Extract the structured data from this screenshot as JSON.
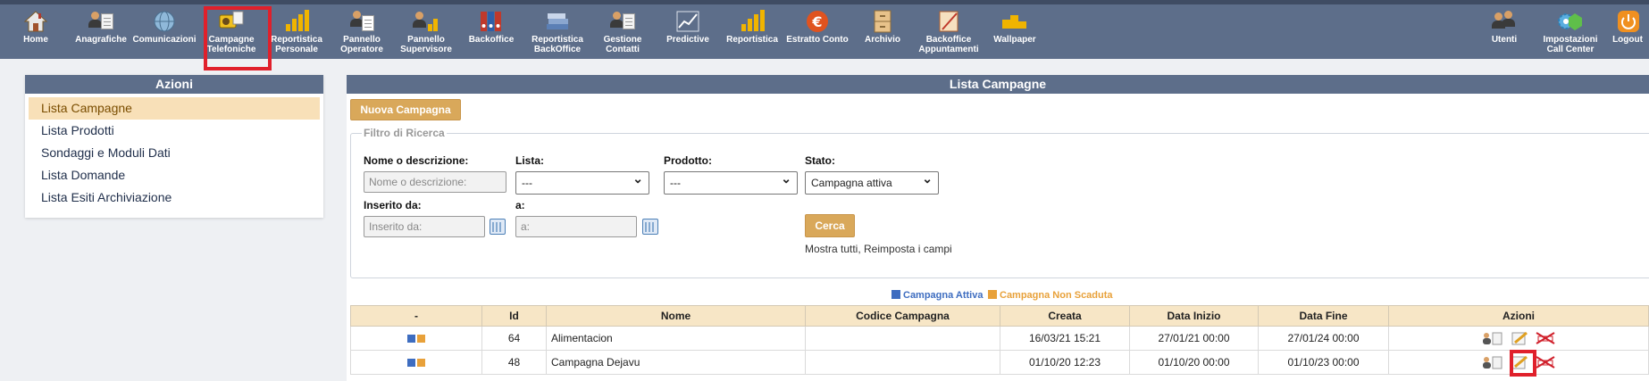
{
  "toolbar": {
    "items": [
      {
        "label": "Home",
        "icon": "home-icon"
      },
      {
        "label": "Anagrafiche",
        "icon": "registry-icon"
      },
      {
        "label": "Comunicazioni",
        "icon": "globe-icon"
      },
      {
        "label": "Campagne Telefoniche",
        "icon": "campaign-icon"
      },
      {
        "label": "Reportistica Personale",
        "icon": "chart-icon"
      },
      {
        "label": "Pannello Operatore",
        "icon": "operator-icon"
      },
      {
        "label": "Pannello Supervisore",
        "icon": "supervisor-icon"
      },
      {
        "label": "Backoffice",
        "icon": "binders-icon"
      },
      {
        "label": "Reportistica BackOffice",
        "icon": "books-icon"
      },
      {
        "label": "Gestione Contatti",
        "icon": "contacts-icon"
      },
      {
        "label": "Predictive",
        "icon": "trend-chart-icon"
      },
      {
        "label": "Reportistica",
        "icon": "bar-chart-icon"
      },
      {
        "label": "Estratto Conto",
        "icon": "euro-icon"
      },
      {
        "label": "Archivio",
        "icon": "cabinet-icon"
      },
      {
        "label": "Backoffice Appuntamenti",
        "icon": "calendar-edit-icon"
      },
      {
        "label": "Wallpaper",
        "icon": "wallpaper-icon"
      },
      {
        "label": "Utenti",
        "icon": "users-icon"
      },
      {
        "label": "Impostazioni Call Center",
        "icon": "settings-icon"
      },
      {
        "label": "Logout",
        "icon": "power-icon"
      }
    ]
  },
  "left_panel": {
    "title": "Azioni",
    "items": [
      "Lista Campagne",
      "Lista Prodotti",
      "Sondaggi e Moduli Dati",
      "Lista Domande",
      "Lista Esiti Archiviazione"
    ]
  },
  "main": {
    "title": "Lista Campagne",
    "new_button": "Nuova Campagna",
    "filter": {
      "legend": "Filtro di Ricerca",
      "name_label": "Nome o descrizione:",
      "name_placeholder": "Nome o descrizione:",
      "list_label": "Lista:",
      "list_value": "---",
      "product_label": "Prodotto:",
      "product_value": "---",
      "state_label": "Stato:",
      "state_value": "Campagna attiva",
      "from_label": "Inserito da:",
      "from_placeholder": "Inserito da:",
      "to_label": "a:",
      "to_placeholder": "a:",
      "search_button": "Cerca",
      "reset_text": "Mostra tutti, Reimposta i campi"
    },
    "legend": {
      "active": "Campagna Attiva",
      "not_expired": "Campagna Non Scaduta"
    },
    "table": {
      "headers": [
        "-",
        "Id",
        "Nome",
        "Codice Campagna",
        "Creata",
        "Data Inizio",
        "Data Fine",
        "Azioni"
      ],
      "rows": [
        {
          "id": "64",
          "name": "Alimentacion",
          "code": "",
          "created": "16/03/21 15:21",
          "start": "27/01/21 00:00",
          "end": "27/01/24 00:00"
        },
        {
          "id": "48",
          "name": "Campagna Dejavu",
          "code": "",
          "created": "01/10/20 12:23",
          "start": "01/10/20 00:00",
          "end": "01/10/23 00:00"
        }
      ]
    }
  },
  "colors": {
    "header_bg": "#5d6e8a",
    "active_blue": "#3e6dc0",
    "not_expired_orange": "#e8a13a",
    "highlight_red": "#e0202b"
  }
}
